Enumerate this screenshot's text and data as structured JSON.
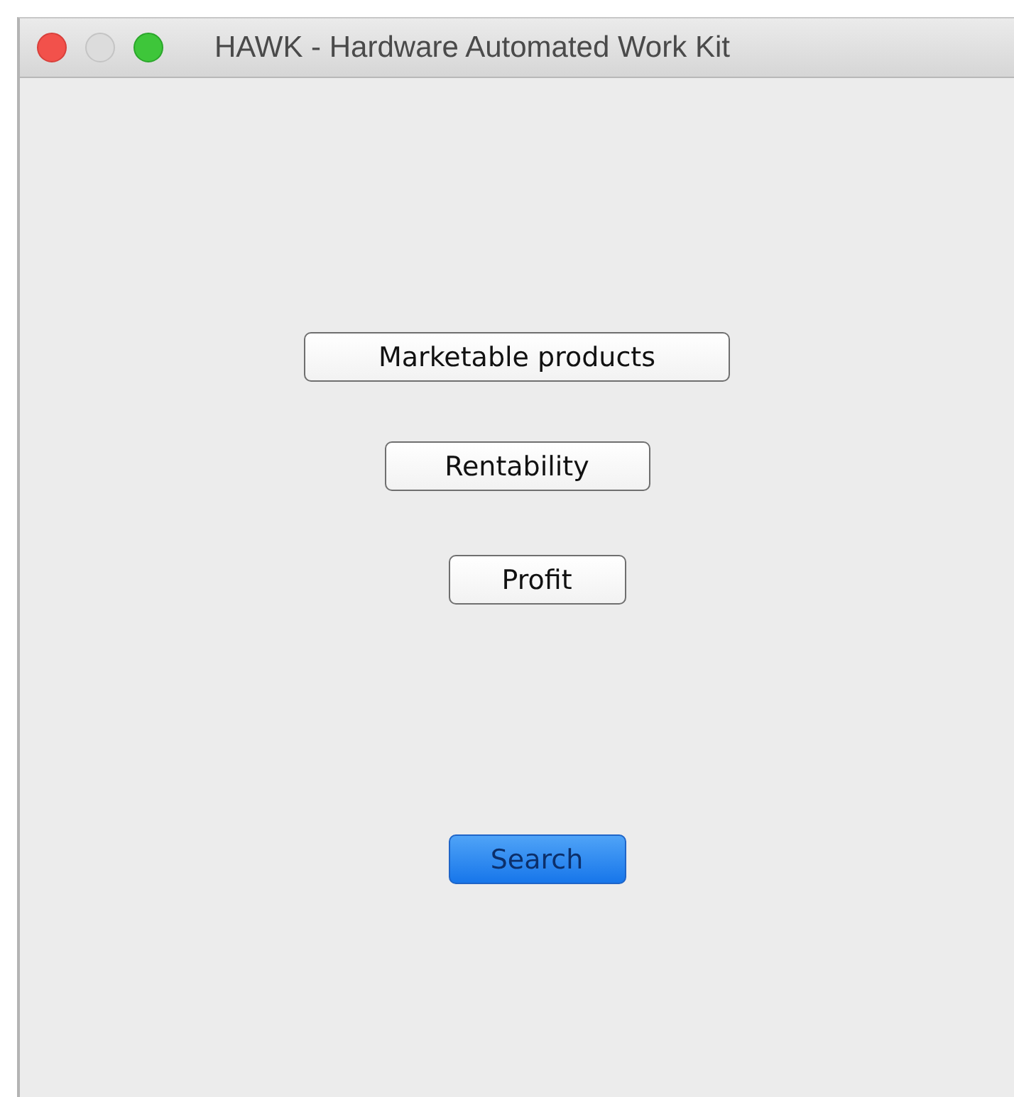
{
  "window": {
    "title": "HAWK - Hardware Automated Work Kit",
    "controls": [
      {
        "kind": "close",
        "disabled": false
      },
      {
        "kind": "minimize",
        "disabled": true
      },
      {
        "kind": "zoom",
        "disabled": false
      }
    ]
  },
  "buttons": [
    {
      "label": "Marketable products",
      "kind": "push"
    },
    {
      "label": "Rentability",
      "kind": "push"
    },
    {
      "label": "Profit",
      "kind": "push"
    },
    {
      "label": "Search",
      "kind": "default"
    }
  ]
}
